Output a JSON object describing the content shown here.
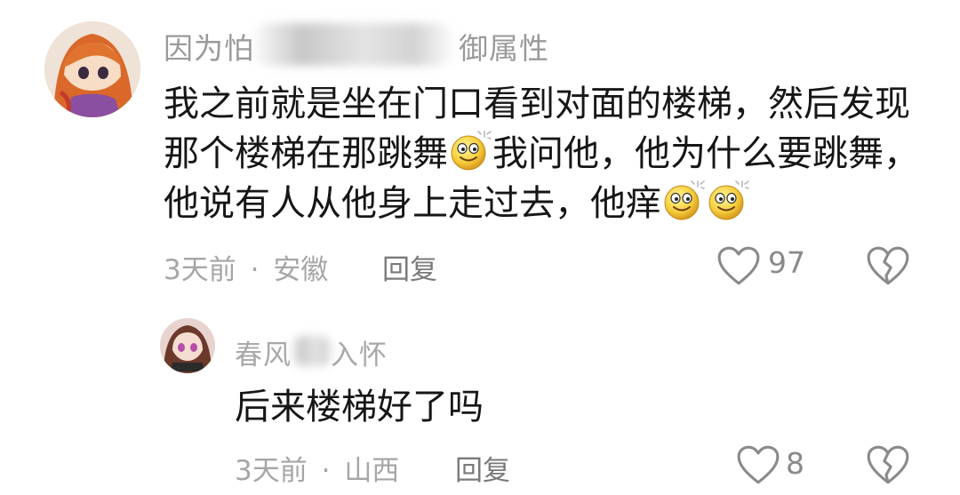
{
  "comments": [
    {
      "username_start": "因为怕",
      "username_end": "御属性",
      "lines": [
        "我之前就是坐在门口看到对面的楼梯，然后发现",
        "那个楼梯在那跳舞",
        "我问他，他为什么要跳舞，",
        "他说有人从他身上走过去，他痒"
      ],
      "time": "3天前",
      "separator": "·",
      "location": "安徽",
      "reply_label": "回复",
      "like_count": "97"
    },
    {
      "username_start": "春风",
      "username_end": "入怀",
      "lines": [
        "后来楼梯好了吗"
      ],
      "time": "3天前",
      "separator": "·",
      "location": "山西",
      "reply_label": "回复",
      "like_count": "8"
    }
  ],
  "icons": {
    "emoji": "smile-icon",
    "like": "heart-outline-icon",
    "dislike": "broken-heart-icon"
  },
  "colors": {
    "text": "#161616",
    "meta": "#a6a6a6",
    "username": "#9a9a9a",
    "icon": "#8a8a8a"
  }
}
